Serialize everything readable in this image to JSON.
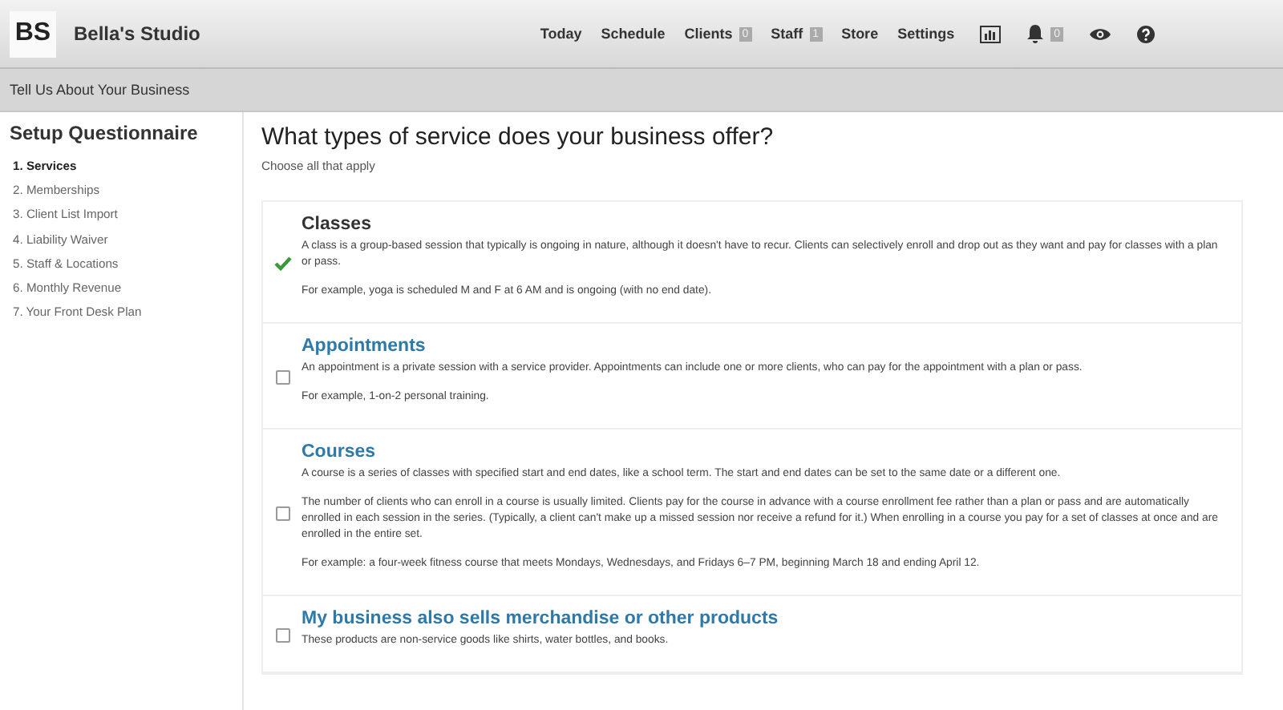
{
  "header": {
    "logo": "BS",
    "studio": "Bella's Studio",
    "nav": [
      {
        "label": "Today"
      },
      {
        "label": "Schedule"
      },
      {
        "label": "Clients",
        "count": "0"
      },
      {
        "label": "Staff",
        "count": "1"
      },
      {
        "label": "Store"
      },
      {
        "label": "Settings"
      }
    ],
    "notifications": "0"
  },
  "subheader": "Tell Us About Your Business",
  "sidebar": {
    "title": "Setup Questionnaire",
    "items": [
      {
        "label": "1. Services",
        "selected": true
      },
      {
        "label": "2. Memberships",
        "selected": false
      },
      {
        "label": "3. Client List Import",
        "selected": false
      },
      {
        "label": "4. Liability Waiver",
        "selected": false
      },
      {
        "label": "5. Staff & Locations",
        "selected": false
      },
      {
        "label": "6. Monthly Revenue",
        "selected": false
      },
      {
        "label": "7. Your Front Desk Plan",
        "selected": false
      }
    ]
  },
  "main": {
    "title": "What types of service does your business offer?",
    "hint": "Choose all that apply",
    "options": [
      {
        "title": "Classes",
        "checked": true,
        "paragraphs": [
          "A class is a group-based session that typically is ongoing in nature, although it doesn't have to recur. Clients can selectively enroll and drop out as they want and pay for classes with a plan or pass.",
          "For example, yoga is scheduled M and F at 6 AM and is ongoing (with no end date)."
        ]
      },
      {
        "title": "Appointments",
        "checked": false,
        "paragraphs": [
          "An appointment is a private session with a service provider. Appointments can include one or more clients, who can pay for the appointment with a plan or pass.",
          "For example, 1-on-2 personal training."
        ]
      },
      {
        "title": "Courses",
        "checked": false,
        "paragraphs": [
          "A course is a series of classes with specified start and end dates, like a school term. The start and end dates can be set to the same date or a different one.",
          "The number of clients who can enroll in a course is usually limited. Clients pay for the course in advance with a course enrollment fee rather than a plan or pass and are automatically enrolled in each session in the series. (Typically, a client can't make up a missed session nor receive a refund for it.) When enrolling in a course you pay for a set of classes at once and are enrolled in the entire set.",
          "For example: a four-week fitness course that meets Mondays, Wednesdays, and Fridays 6–7 PM, beginning March 18 and ending April 12."
        ]
      },
      {
        "title": "My business also sells merchandise or other products",
        "checked": false,
        "paragraphs": [
          "These products are non-service goods like shirts, water bottles, and books."
        ]
      }
    ]
  }
}
